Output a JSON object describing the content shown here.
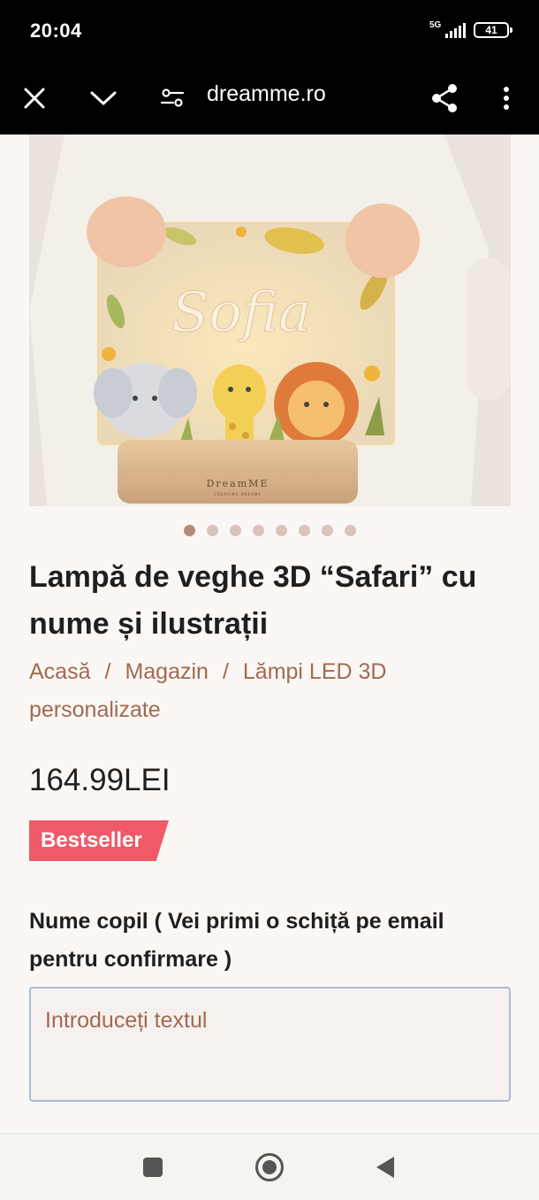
{
  "status_bar": {
    "time": "20:04",
    "network": "5G",
    "battery": "41",
    "signal_icon": "signal-bars-icon",
    "battery_icon": "battery-icon"
  },
  "browser": {
    "url": "dreamme.ro",
    "icons": [
      "close-icon",
      "chevron-down-icon",
      "site-settings-icon",
      "share-icon",
      "more-vert-icon"
    ]
  },
  "product": {
    "image": {
      "name_text": "Sofia",
      "brand_text": "DreamME",
      "brand_tagline": "CREATING DREAMS"
    },
    "carousel": {
      "total": 8,
      "active": 1
    },
    "title": "Lampă de veghe 3D “Safari” cu nume și ilustrații",
    "breadcrumb": {
      "home": "Acasă",
      "separator": "/",
      "shop": "Magazin",
      "category": "Lămpi LED 3D personalizate"
    },
    "price": "164.99LEI",
    "badge": "Bestseller",
    "field_label": "Nume copil ( Vei primi o schiță pe email pentru confirmare )",
    "field_placeholder": "Introduceți textul"
  },
  "colors": {
    "accent_link": "#a06a52",
    "badge_bg": "#ef5a68",
    "dot_active": "#b88a7c",
    "dot_inactive": "#d9c3bb",
    "input_border": "#a9bcd2"
  },
  "nav_bar": {
    "icons": [
      "recents-square-icon",
      "home-circle-icon",
      "back-triangle-icon"
    ]
  }
}
